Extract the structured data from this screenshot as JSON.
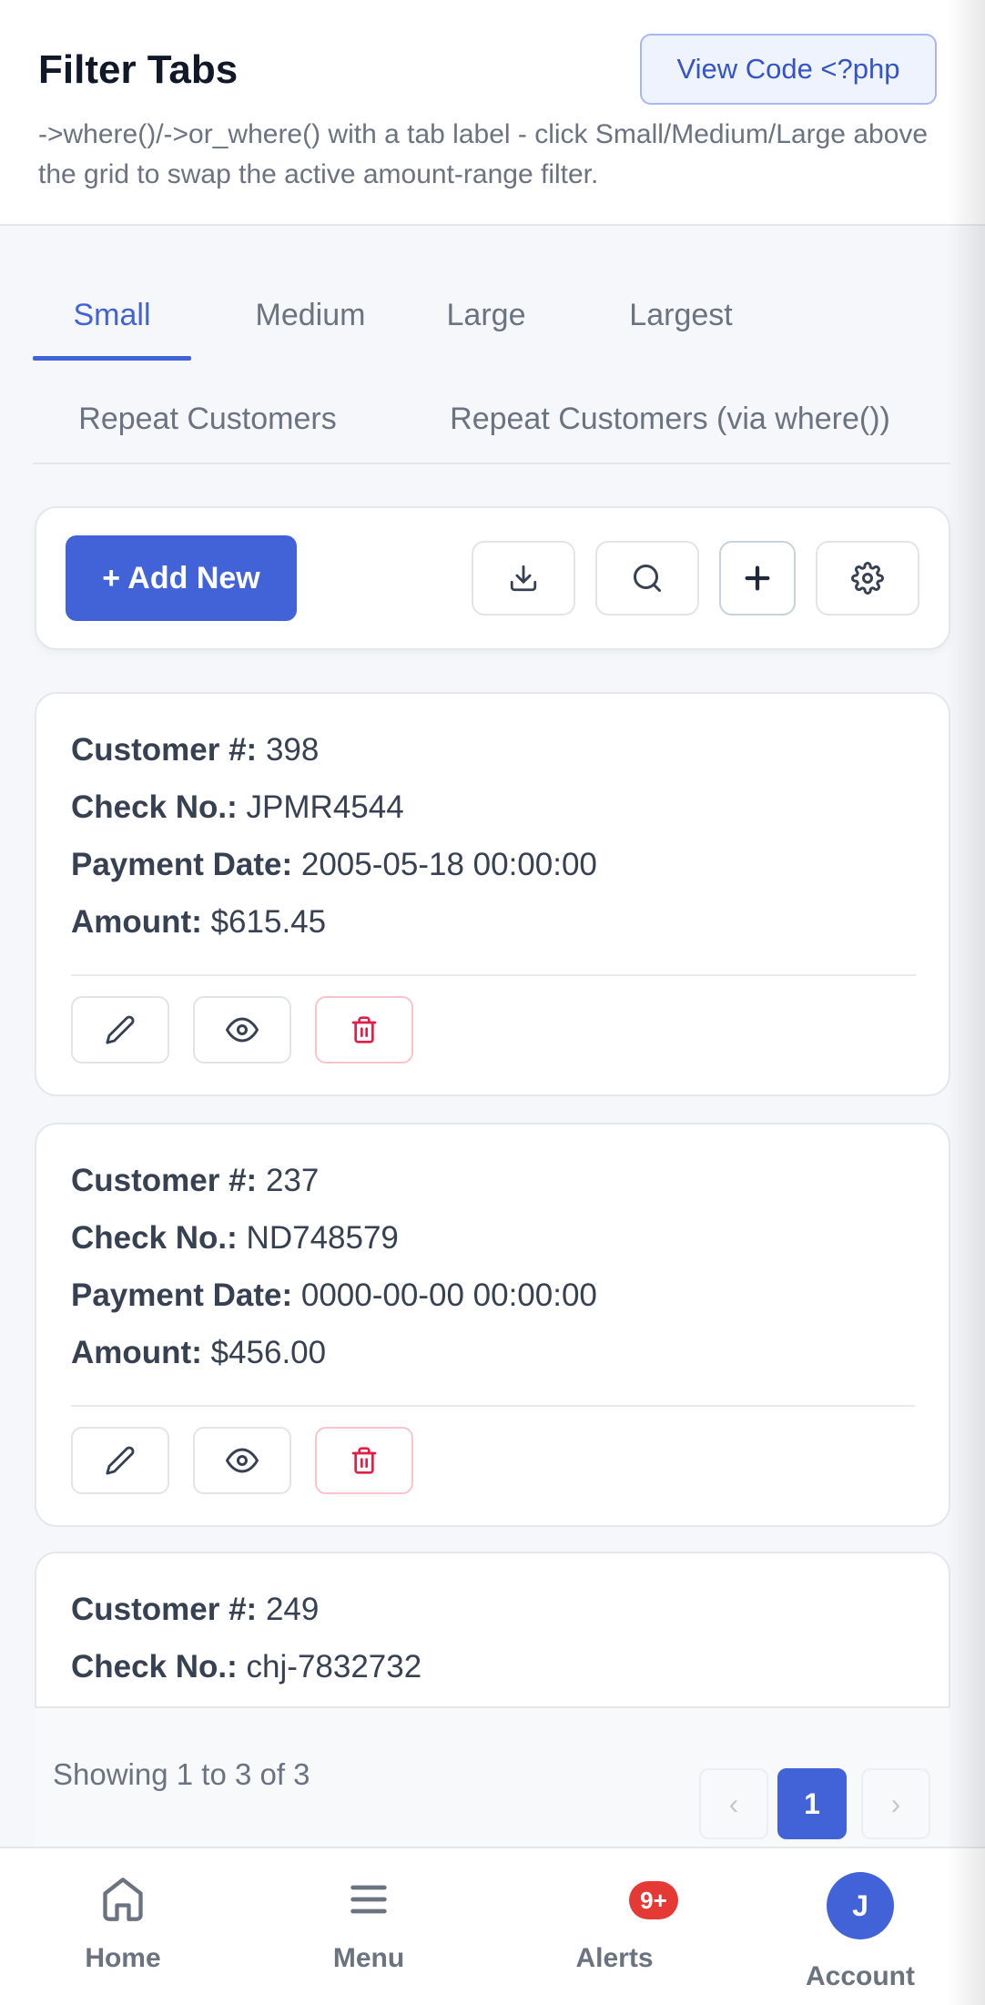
{
  "header": {
    "title": "Filter Tabs",
    "subtitle": "->where()/->or_where() with a tab label - click Small/Medium/Large above the grid to swap the active amount-range filter.",
    "view_code_label": "View Code <?php"
  },
  "tabs": {
    "active": "Small",
    "row1": [
      "Small",
      "Medium",
      "Large",
      "Largest"
    ],
    "row2": [
      "Repeat Customers",
      "Repeat Customers (via where())"
    ]
  },
  "toolbar": {
    "add_new_label": "+ Add New",
    "icons": [
      "download-icon",
      "search-icon",
      "plus-icon",
      "gear-icon"
    ]
  },
  "field_labels": {
    "customer": "Customer #:",
    "check": "Check No.:",
    "date": "Payment Date:",
    "amount": "Amount:"
  },
  "records": [
    {
      "customer": "398",
      "check": "JPMR4544",
      "date": "2005-05-18 00:00:00",
      "amount": "$615.45"
    },
    {
      "customer": "237",
      "check": "ND748579",
      "date": "0000-00-00 00:00:00",
      "amount": "$456.00"
    },
    {
      "customer": "249",
      "check": "chj-7832732"
    }
  ],
  "pagination": {
    "summary": "Showing 1 to 3 of 3",
    "prev": "‹",
    "current": "1",
    "next": "›"
  },
  "bottom_nav": {
    "home": "Home",
    "menu": "Menu",
    "alerts": "Alerts",
    "alerts_badge": "9+",
    "account": "Account",
    "account_initial": "J"
  },
  "colors": {
    "accent": "#4263d8",
    "danger": "#e11d48",
    "badge": "#e53935"
  }
}
